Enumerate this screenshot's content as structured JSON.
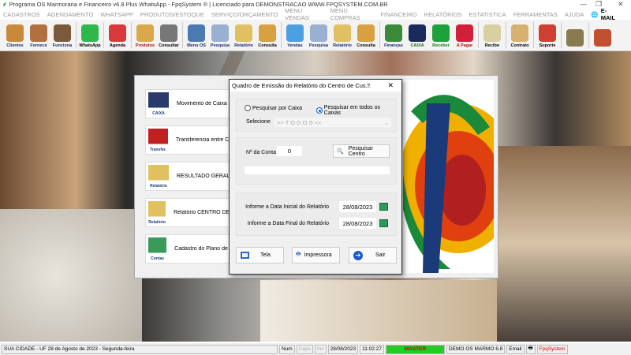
{
  "window": {
    "title": "Programa OS Marmoraria e Financeiro v6.8 Plus WhatsApp - FpqSystem ® | Licenciado para  DEMONSTRACAO WWW.FPQSYSTEM.COM.BR",
    "minimize": "—",
    "maximize": "❐",
    "close": "✕"
  },
  "menu": [
    "CADASTROS",
    "AGENDAMENTO",
    "WHATSAPP",
    "PRODUTOS/ESTOQUE",
    "SERVIÇO/ORÇAMENTO",
    "MENU VENDAS",
    "MENU COMPRAS",
    "FINANCEIRO",
    "RELATÓRIOS",
    "ESTATISTICA",
    "FERRAMENTAS",
    "AJUDA"
  ],
  "menu_email": "E-MAIL",
  "toolbar": [
    {
      "label": "Clientes",
      "color": "#c88a3a",
      "text": "#1a2a6a"
    },
    {
      "label": "Fornece",
      "color": "#b07040",
      "text": "#1a2a6a"
    },
    {
      "label": "Funciona",
      "color": "#7a5a3a",
      "text": "#1a2a6a"
    },
    {
      "label": "WhatsApp",
      "color": "#2fb84a",
      "text": "#000"
    },
    {
      "label": "Agenda",
      "color": "#d83a3a",
      "text": "#000"
    },
    {
      "label": "Produtos",
      "color": "#d8a84a",
      "text": "#b01010"
    },
    {
      "label": "Consultar",
      "color": "#777777",
      "text": "#000"
    },
    {
      "label": "Menu OS",
      "color": "#4a7ab0",
      "text": "#1a2a6a"
    },
    {
      "label": "Pesquisa",
      "color": "#9ab0d0",
      "text": "#1a2a6a"
    },
    {
      "label": "Relatório",
      "color": "#e0c060",
      "text": "#1a2a6a"
    },
    {
      "label": "Consulta",
      "color": "#d8a040",
      "text": "#000"
    },
    {
      "label": "Vendas",
      "color": "#4aa0e0",
      "text": "#1a2a6a"
    },
    {
      "label": "Pesquisa",
      "color": "#9ab0d0",
      "text": "#1a2a6a"
    },
    {
      "label": "Relatório",
      "color": "#e0c060",
      "text": "#1a2a6a"
    },
    {
      "label": "Consulta",
      "color": "#d8a040",
      "text": "#000"
    },
    {
      "label": "Finanças",
      "color": "#3a8a3a",
      "text": "#1a2a6a"
    },
    {
      "label": "CAIXA",
      "color": "#1a2a5a",
      "text": "#1a6a1a"
    },
    {
      "label": "Receber",
      "color": "#1ea03a",
      "text": "#1a7a1a"
    },
    {
      "label": "A Pagar",
      "color": "#d0203a",
      "text": "#b01010"
    },
    {
      "label": "Recibo",
      "color": "#d8d0a0",
      "text": "#000"
    },
    {
      "label": "Contrato",
      "color": "#d8b070",
      "text": "#000"
    },
    {
      "label": "Suporte",
      "color": "#d04030",
      "text": "#000"
    },
    {
      "label": "",
      "color": "#8a7a50",
      "text": "#000"
    },
    {
      "label": "",
      "color": "#c05030",
      "text": "#000"
    }
  ],
  "side_buttons": [
    {
      "icon_label": "CAIXA",
      "label": "Movimento de Caixa"
    },
    {
      "icon_label": "Transfer.",
      "label": "Transferencia entre Caixas"
    },
    {
      "icon_label": "Relatório",
      "label": "RESULTADO GERAL"
    },
    {
      "icon_label": "Relatório",
      "label": "Relatório CENTRO DE CUSTO"
    },
    {
      "icon_label": "Contas",
      "label": "Cadastro do Plano de Contas"
    }
  ],
  "dialog": {
    "title": "Quadro de Emissão do Relatório do Centro de Cus...",
    "help": "?",
    "close": "✕",
    "radio_caixa": "Pesquisar por Caixa",
    "radio_todos": "Pesquisar em todos os Caixas",
    "selected_radio": "todos",
    "selecione_label": "Selecione",
    "selecione_value": ">> T O D O S <<",
    "conta_label": "Nº da Conta",
    "conta_value": "0",
    "pesquisar_centro": "Pesquisar Centro",
    "centro_nome": "",
    "data_inicial_label": "Informe a Data Inicial do Relatório",
    "data_inicial": "28/08/2023",
    "data_final_label": "Informe a Data Final do Relatório",
    "data_final": "28/08/2023",
    "tela": "Tela",
    "impressora": "Impressora",
    "sair": "Sair"
  },
  "status": {
    "city": "SUA CIDADE - UF 28 de Agosto de 2023 - Segunda-feira",
    "num": "Num",
    "caps": "Caps",
    "ins": "Ins",
    "date": "28/08/2023",
    "time": "11:02:27",
    "user": "MASTER",
    "company": "DEMO OS MARMO 6.8",
    "email": "Email",
    "brand": "FpqSystem"
  }
}
